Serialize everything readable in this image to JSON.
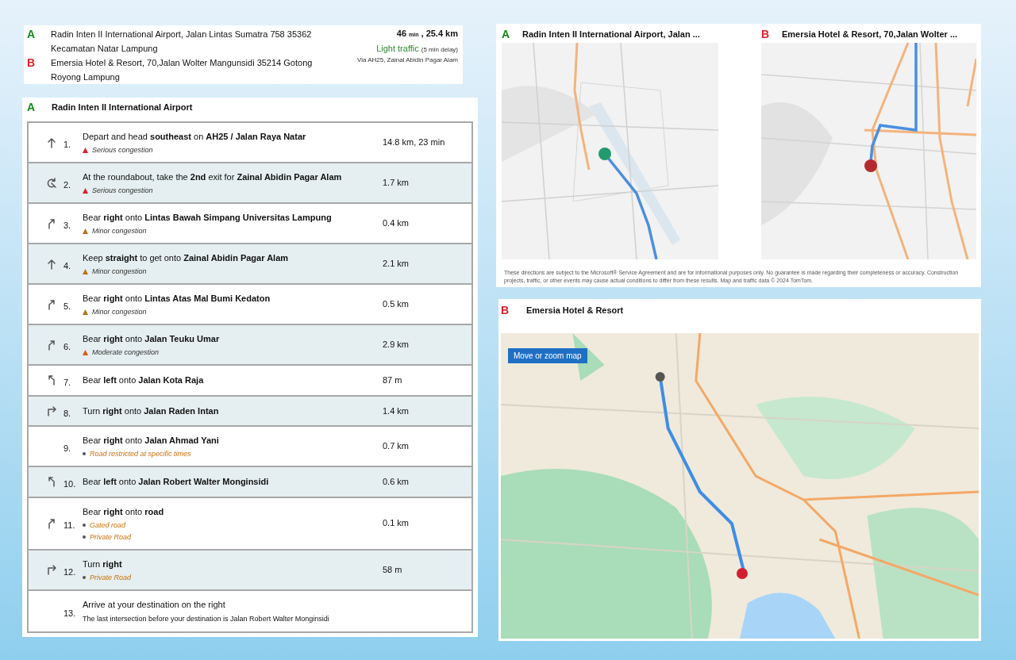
{
  "summary": {
    "start": {
      "marker": "A",
      "color": "#138a13",
      "address": "Radin Inten II International Airport, Jalan Lintas Sumatra 758 35362 Kecamatan Natar Lampung"
    },
    "end": {
      "marker": "B",
      "color": "#e0202a",
      "address": "Emersia Hotel & Resort, 70,Jalan Wolter Mangunsidi 35214 Gotong Royong Lampung"
    },
    "duration": "46",
    "duration_unit": "min",
    "distance": ", 25.4 km",
    "traffic": "Light traffic",
    "delay": "(5 min delay)",
    "via": "Via AH25, Zainal Abidin Pagar Alam"
  },
  "directions": {
    "start": {
      "marker": "A",
      "color": "#138a13",
      "name": "Radin Inten II International Airport"
    },
    "steps": [
      {
        "kind": "straight",
        "number": "1.",
        "instruction": "Depart and head **southeast** on **AH25 / Jalan Raya Natar**",
        "notes": [
          {
            "kind": "congestion",
            "color": "#d9202a",
            "text": "Serious congestion"
          }
        ],
        "distance": "14.8 km, 23 min"
      },
      {
        "kind": "roundabout",
        "number": "2.",
        "instruction": "At the roundabout, take the **2nd** exit for **Zainal Abidin Pagar Alam**",
        "notes": [
          {
            "kind": "congestion",
            "color": "#d9202a",
            "text": "Serious congestion"
          }
        ],
        "distance": "1.7 km"
      },
      {
        "kind": "bear_right",
        "number": "3.",
        "instruction": "Bear **right** onto **Lintas Bawah Simpang Universitas Lampung**",
        "notes": [
          {
            "kind": "congestion",
            "color": "#b8731a",
            "text": "Minor congestion"
          }
        ],
        "distance": "0.4 km"
      },
      {
        "kind": "straight",
        "number": "4.",
        "instruction": "Keep **straight** to get onto **Zainal Abidin Pagar Alam**",
        "notes": [
          {
            "kind": "congestion",
            "color": "#b8731a",
            "text": "Minor congestion"
          }
        ],
        "distance": "2.1 km"
      },
      {
        "kind": "bear_right",
        "number": "5.",
        "instruction": "Bear **right** onto **Lintas Atas Mal Bumi Kedaton**",
        "notes": [
          {
            "kind": "congestion",
            "color": "#b8731a",
            "text": "Minor congestion"
          }
        ],
        "distance": "0.5 km"
      },
      {
        "kind": "bear_right",
        "number": "6.",
        "instruction": "Bear **right** onto **Jalan Teuku Umar**",
        "notes": [
          {
            "kind": "congestion",
            "color": "#e0581a",
            "text": "Moderate congestion"
          }
        ],
        "distance": "2.9 km"
      },
      {
        "kind": "bear_left",
        "number": "7.",
        "instruction": "Bear **left** onto **Jalan Kota Raja**",
        "distance": "87 m"
      },
      {
        "kind": "turn_right",
        "number": "8.",
        "instruction": "Turn **right** onto **Jalan Raden Intan**",
        "distance": "1.4 km"
      },
      {
        "number": "9.",
        "instruction": "Bear **right** onto **Jalan Ahmad Yani**",
        "notes": [
          {
            "kind": "restriction",
            "text": "Road restricted at specific times"
          }
        ],
        "distance": "0.7 km"
      },
      {
        "kind": "bear_left",
        "number": "10.",
        "instruction": "Bear **left** onto **Jalan Robert Walter Monginsidi**",
        "distance": "0.6 km"
      },
      {
        "kind": "bear_right",
        "number": "11.",
        "instruction": "Bear **right** onto **road**",
        "notes": [
          {
            "kind": "restriction",
            "text": "Gated road"
          },
          {
            "kind": "restriction",
            "text": "Private Road"
          }
        ],
        "distance": "0.1 km"
      },
      {
        "kind": "turn_right",
        "number": "12.",
        "instruction": "Turn **right**",
        "notes": [
          {
            "kind": "restriction",
            "text": "Private Road"
          }
        ],
        "distance": "58 m"
      },
      {
        "number": "13.",
        "instruction": "Arrive at your destination on the right",
        "detail": "The last intersection before your destination is Jalan Robert Walter Monginsidi"
      }
    ]
  },
  "overview_maps": [
    {
      "marker": "A",
      "color": "#138a13",
      "title": "Radin Inten II International Airport, Jalan ...",
      "kind": "start"
    },
    {
      "marker": "B",
      "color": "#e0202a",
      "title": "Emersia Hotel & Resort, 70,Jalan Wolter ...",
      "kind": "end"
    }
  ],
  "disclaimer": "These directions are subject to the Microsoft® Service Agreement and are for informational purposes only. No guarantee is made regarding their completeness or accuracy. Construction projects, traffic, or other events may cause actual conditions to differ from these results. Map and traffic data © 2024 TomTom.",
  "destination_map": {
    "marker": "B",
    "color": "#e0202a",
    "title": "Emersia Hotel & Resort",
    "button": "Move or zoom map"
  }
}
